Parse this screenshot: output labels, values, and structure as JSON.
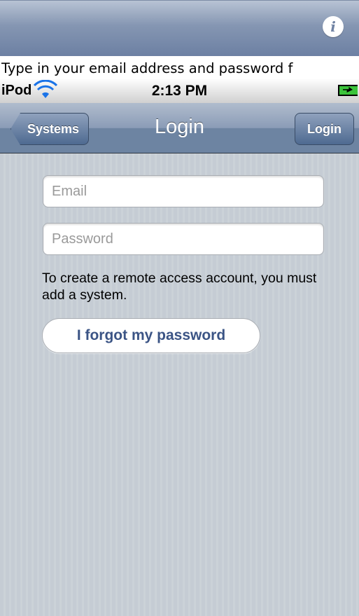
{
  "caption": "Type in your email address and password f",
  "status_bar": {
    "carrier": "iPod",
    "time": "2:13 PM"
  },
  "nav": {
    "back_label": "Systems",
    "title": "Login",
    "login_label": "Login"
  },
  "form": {
    "email_placeholder": "Email",
    "password_placeholder": "Password",
    "info_text": "To create a remote access account, you must add a system.",
    "forgot_label": "I forgot my password"
  },
  "icons": {
    "info": "info-icon",
    "wifi": "wifi-icon",
    "battery": "battery-charging-icon"
  },
  "colors": {
    "nav_accent": "#6d84a2",
    "link_text": "#3b5485",
    "background": "#c5ccd4"
  }
}
